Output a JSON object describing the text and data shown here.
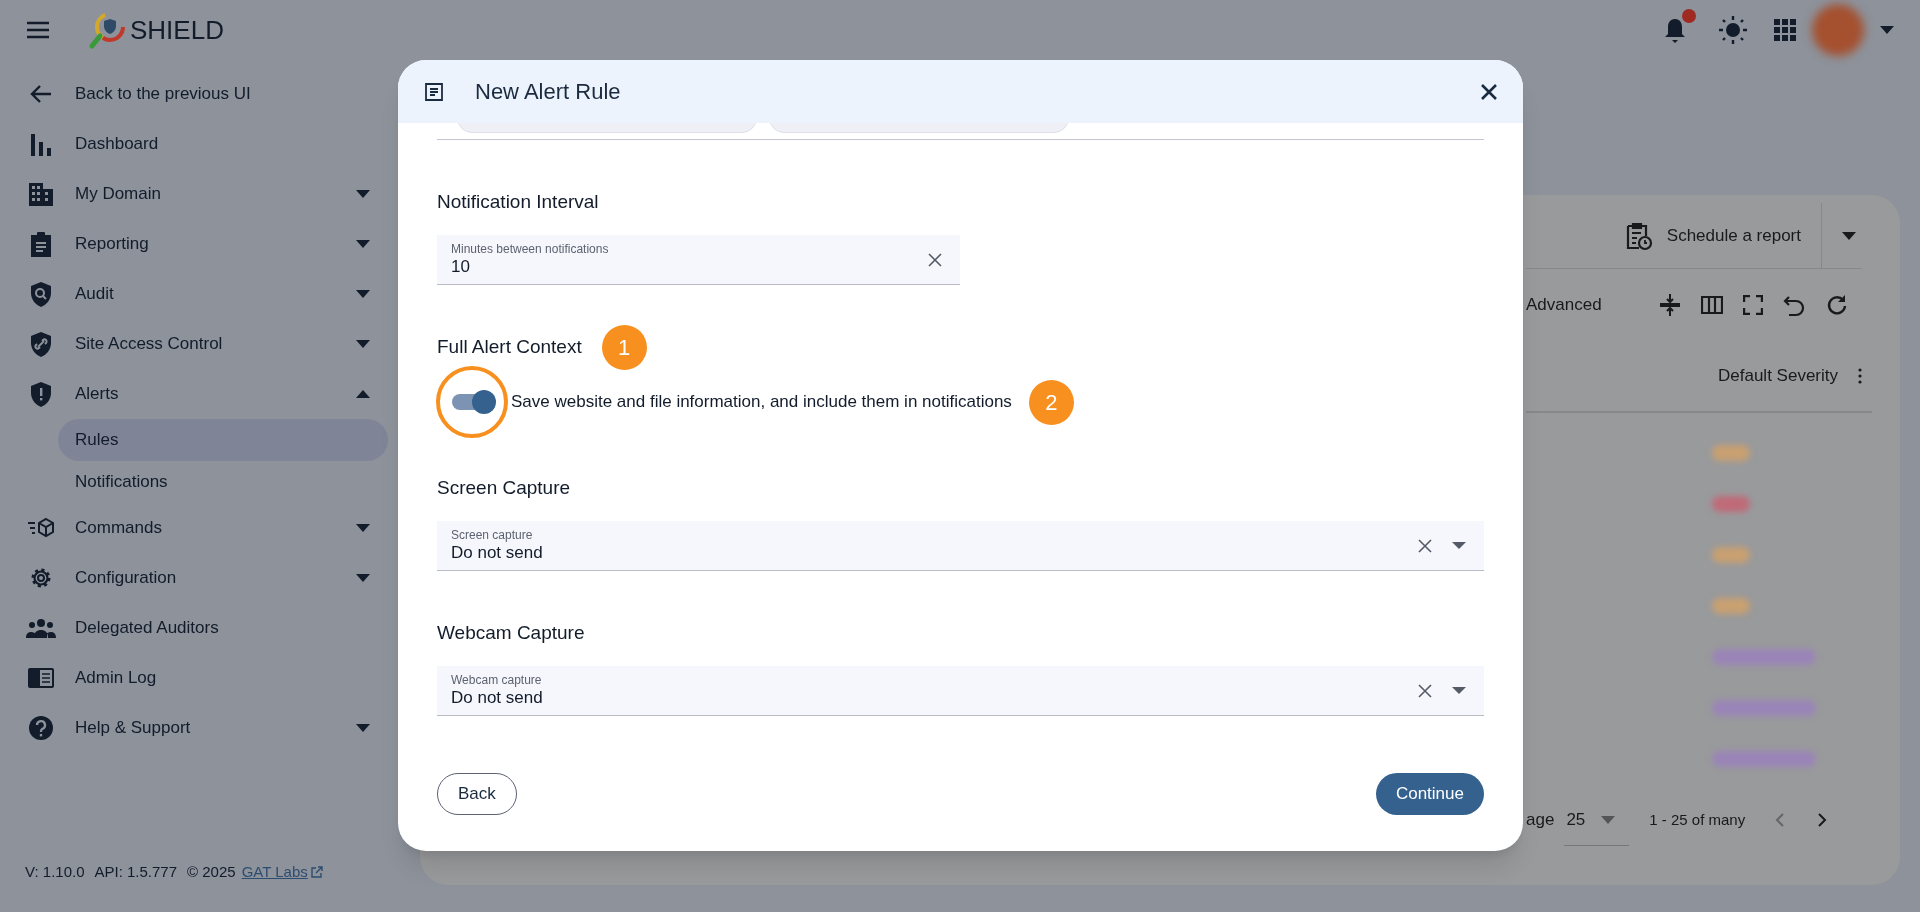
{
  "app": {
    "title": "SHIELD"
  },
  "topbar": {
    "notification_dot": true
  },
  "sidebar": {
    "items": [
      {
        "label": "Back to the previous UI",
        "expandable": false,
        "selected": false
      },
      {
        "label": "Dashboard",
        "expandable": false,
        "selected": false
      },
      {
        "label": "My Domain",
        "expandable": true,
        "expanded": false,
        "selected": false
      },
      {
        "label": "Reporting",
        "expandable": true,
        "expanded": false,
        "selected": false
      },
      {
        "label": "Audit",
        "expandable": true,
        "expanded": false,
        "selected": false
      },
      {
        "label": "Site Access Control",
        "expandable": true,
        "expanded": false,
        "selected": false
      },
      {
        "label": "Alerts",
        "expandable": true,
        "expanded": true,
        "selected": false,
        "children": [
          {
            "label": "Rules",
            "selected": true
          },
          {
            "label": "Notifications",
            "selected": false
          }
        ]
      },
      {
        "label": "Commands",
        "expandable": true,
        "expanded": false,
        "selected": false
      },
      {
        "label": "Configuration",
        "expandable": true,
        "expanded": false,
        "selected": false
      },
      {
        "label": "Delegated Auditors",
        "expandable": false,
        "selected": false
      },
      {
        "label": "Admin Log",
        "expandable": false,
        "selected": false
      },
      {
        "label": "Help & Support",
        "expandable": true,
        "expanded": false,
        "selected": false
      }
    ],
    "footer": {
      "version": "V: 1.10.0",
      "api": "API: 1.5.777",
      "copyright": "© 2025",
      "link": "GAT Labs"
    }
  },
  "background": {
    "schedule_button": "Schedule a report",
    "filter_label": "Advanced",
    "column_header": "Default Severity",
    "severity_badges": [
      {
        "color": "#c9a070",
        "wide": false
      },
      {
        "color": "#c06a78",
        "wide": false
      },
      {
        "color": "#c9a070",
        "wide": false
      },
      {
        "color": "#c9a070",
        "wide": false
      },
      {
        "color": "#9a84b8",
        "wide": true
      },
      {
        "color": "#9a84b8",
        "wide": true
      },
      {
        "color": "#9a84b8",
        "wide": true
      }
    ],
    "pagination": {
      "label": "age",
      "page_size": "25",
      "range": "1 - 25 of many"
    }
  },
  "dialog": {
    "title": "New Alert Rule",
    "sections": [
      {
        "kind": "chips"
      },
      {
        "kind": "number",
        "heading": "Notification Interval",
        "label": "Minutes between notifications",
        "value": "10"
      },
      {
        "kind": "toggle",
        "heading": "Full Alert Context",
        "heading_step": "1",
        "label": "Save website and file information, and include them in notifications",
        "on": true,
        "highlighted": true,
        "step": "2"
      },
      {
        "kind": "select",
        "heading": "Screen Capture",
        "label": "Screen capture",
        "value": "Do not send"
      },
      {
        "kind": "select",
        "heading": "Webcam Capture",
        "label": "Webcam capture",
        "value": "Do not send"
      }
    ],
    "buttons": [
      {
        "kind": "outline",
        "label": "Back"
      },
      {
        "kind": "filled",
        "label": "Continue"
      }
    ]
  }
}
